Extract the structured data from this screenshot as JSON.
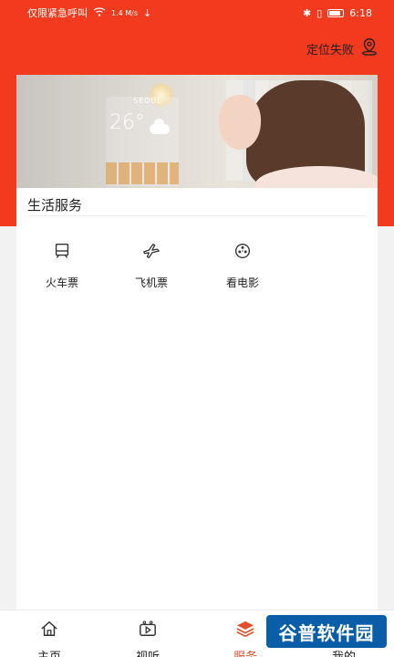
{
  "status_bar": {
    "left_text": "仅限紧急呼叫",
    "network_speed": "1.4 M/s",
    "time": "6:18"
  },
  "header": {
    "location_text": "定位失败"
  },
  "banner": {
    "weather_city": "SEOUL",
    "weather_temp": "26°"
  },
  "section": {
    "title": "生活服务"
  },
  "services": [
    {
      "label": "火车票",
      "icon": "train-icon"
    },
    {
      "label": "飞机票",
      "icon": "plane-icon"
    },
    {
      "label": "看电影",
      "icon": "film-reel-icon"
    }
  ],
  "tabs": [
    {
      "label": "主页",
      "icon": "home-icon"
    },
    {
      "label": "视听",
      "icon": "video-icon"
    },
    {
      "label": "服务",
      "icon": "layers-icon",
      "active": true
    },
    {
      "label": "我的",
      "icon": "user-icon"
    }
  ],
  "watermark": {
    "text": "谷普软件园"
  },
  "colors": {
    "header_red": "#f23a1e",
    "active_tab": "#e0512b"
  }
}
